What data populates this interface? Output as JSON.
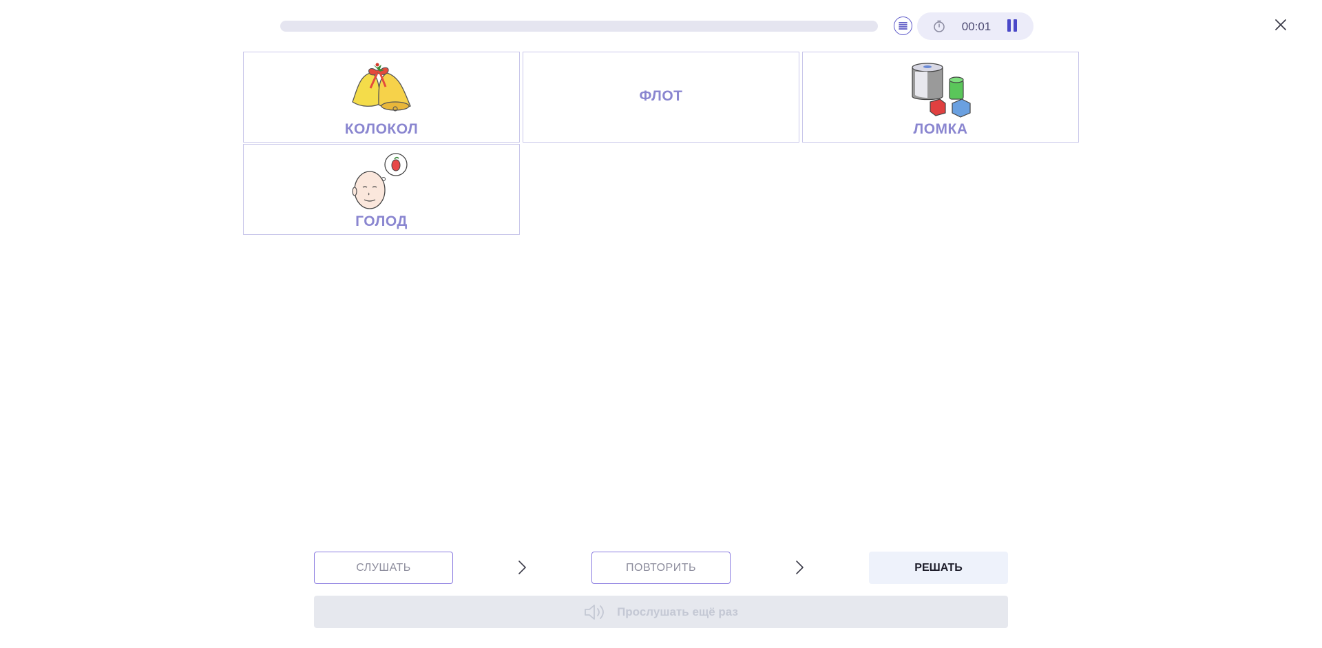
{
  "progress": {
    "fraction": 0.0
  },
  "timer": {
    "time": "00:01"
  },
  "cards": [
    {
      "word": "КОЛОКОЛ",
      "icon": "bells-icon"
    },
    {
      "word": "ФЛОТ",
      "icon": ""
    },
    {
      "word": "ЛОМКА",
      "icon": "broken-toys-icon"
    },
    {
      "word": "ГОЛОД",
      "icon": "hungry-face-icon"
    }
  ],
  "steps": {
    "listen_label": "СЛУШАТЬ",
    "repeat_label": "ПОВТОРИТЬ",
    "solve_label": "РЕШАТЬ"
  },
  "replay": {
    "label": "Прослушать ещё раз"
  },
  "colors": {
    "accent": "#5a56c8",
    "card_border": "#c9c7ea",
    "card_text": "#8a86d0",
    "timer_bg": "#ececf9"
  }
}
